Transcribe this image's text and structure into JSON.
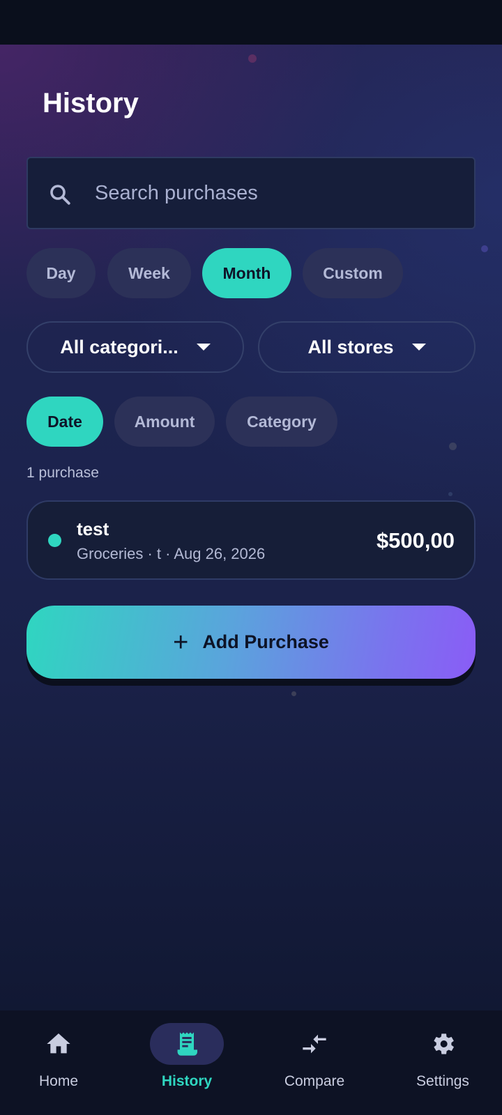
{
  "header": {
    "title": "History"
  },
  "search": {
    "placeholder": "Search purchases",
    "value": ""
  },
  "period_filters": [
    {
      "label": "Day",
      "active": false
    },
    {
      "label": "Week",
      "active": false
    },
    {
      "label": "Month",
      "active": true
    },
    {
      "label": "Custom",
      "active": false
    }
  ],
  "dropdowns": {
    "category": {
      "label": "All categori..."
    },
    "store": {
      "label": "All stores"
    }
  },
  "sort_options": [
    {
      "label": "Date",
      "active": true
    },
    {
      "label": "Amount",
      "active": false
    },
    {
      "label": "Category",
      "active": false
    }
  ],
  "summary": {
    "count_label": "1 purchase"
  },
  "purchases": [
    {
      "name": "test",
      "meta": "Groceries · t · Aug 26, 2026",
      "amount": "$500,00",
      "color": "#2fd6c0"
    }
  ],
  "actions": {
    "add_purchase_label": "Add Purchase"
  },
  "nav": [
    {
      "label": "Home",
      "icon": "home-icon",
      "active": false
    },
    {
      "label": "History",
      "icon": "receipt-icon",
      "active": true
    },
    {
      "label": "Compare",
      "icon": "compare-arrows-icon",
      "active": false
    },
    {
      "label": "Settings",
      "icon": "gear-icon",
      "active": false
    }
  ],
  "colors": {
    "accent": "#2fd6c0",
    "gradient_end": "#8a5cf6",
    "background": "#1d2450",
    "chip_inactive": "#2c3158"
  }
}
